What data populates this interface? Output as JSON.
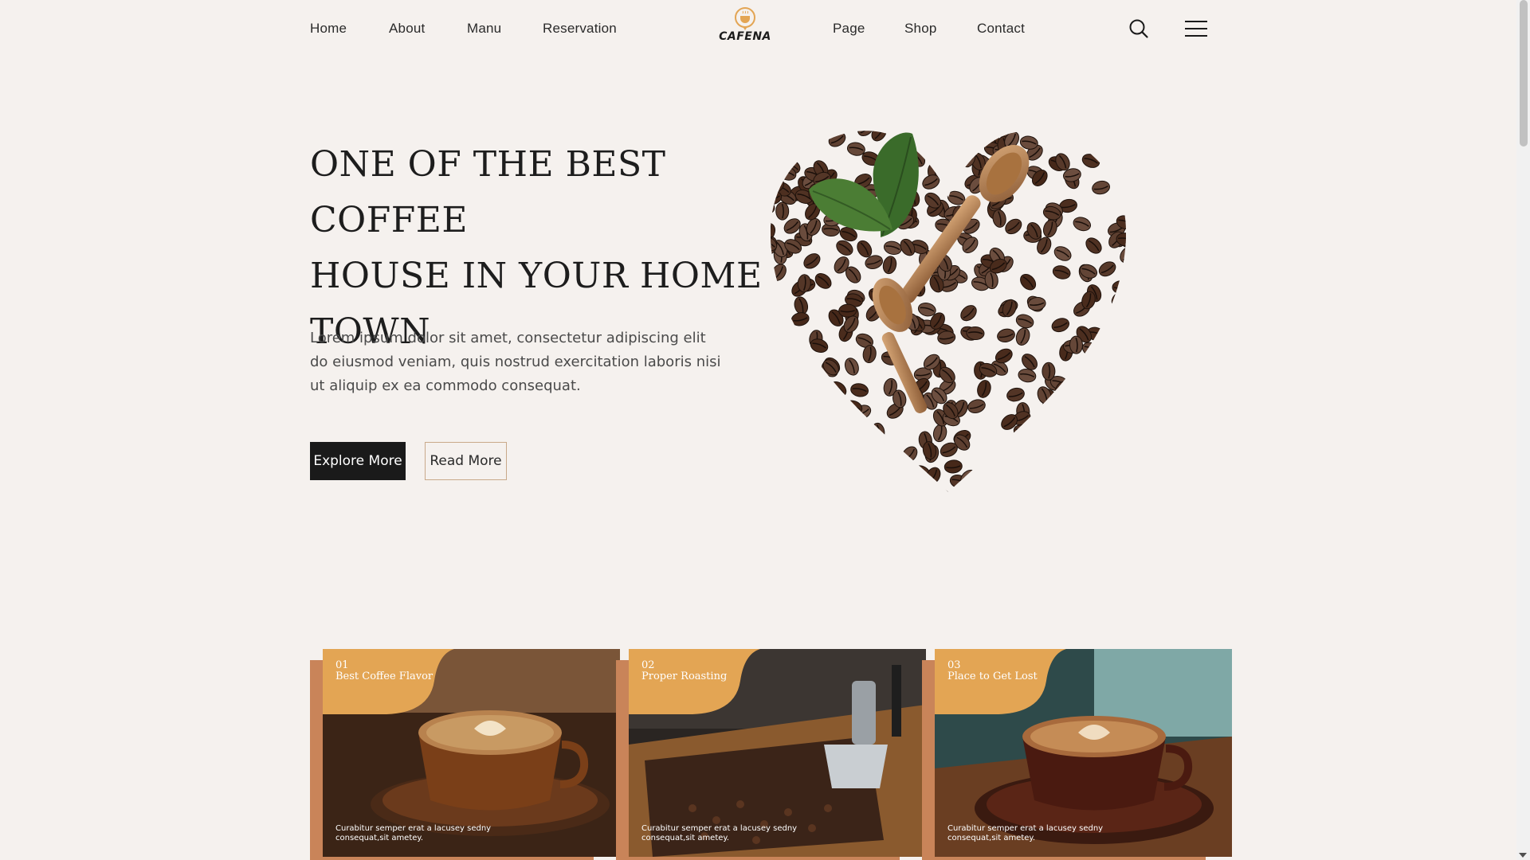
{
  "nav": {
    "left_links": [
      "Home",
      "About",
      "Manu",
      "Reservation"
    ],
    "right_links": [
      "Page",
      "Shop",
      "Contact"
    ],
    "logo_text": "CAFENA",
    "icons": [
      "search-icon",
      "menu-icon"
    ]
  },
  "hero": {
    "title_lines": [
      "ONE OF THE BEST COFFEE",
      "HOUSE IN YOUR HOME",
      "TOWN"
    ],
    "description": "Lorem ipsum dolor sit amet, consectetur adipiscing elit do eiusmod veniam, quis nostrud exercitation laboris nisi ut aliquip ex ea commodo consequat.",
    "primary_button": "Explore More",
    "secondary_button": "Read More"
  },
  "features": [
    {
      "number": "01",
      "title": "Best Coffee Flavor",
      "description": "Curabitur semper erat a lacusey sedny consequat,sit ametey."
    },
    {
      "number": "02",
      "title": "Proper Roasting",
      "description": "Curabitur semper erat a lacusey sedny consequat,sit ametey."
    },
    {
      "number": "03",
      "title": "Place to Get Lost",
      "description": "Curabitur semper erat a lacusey sedny consequat,sit ametey."
    }
  ],
  "colors": {
    "background": "#f5f1ee",
    "accent": "#c98459",
    "tag": "#e3a554",
    "dark": "#1a1a1a"
  }
}
